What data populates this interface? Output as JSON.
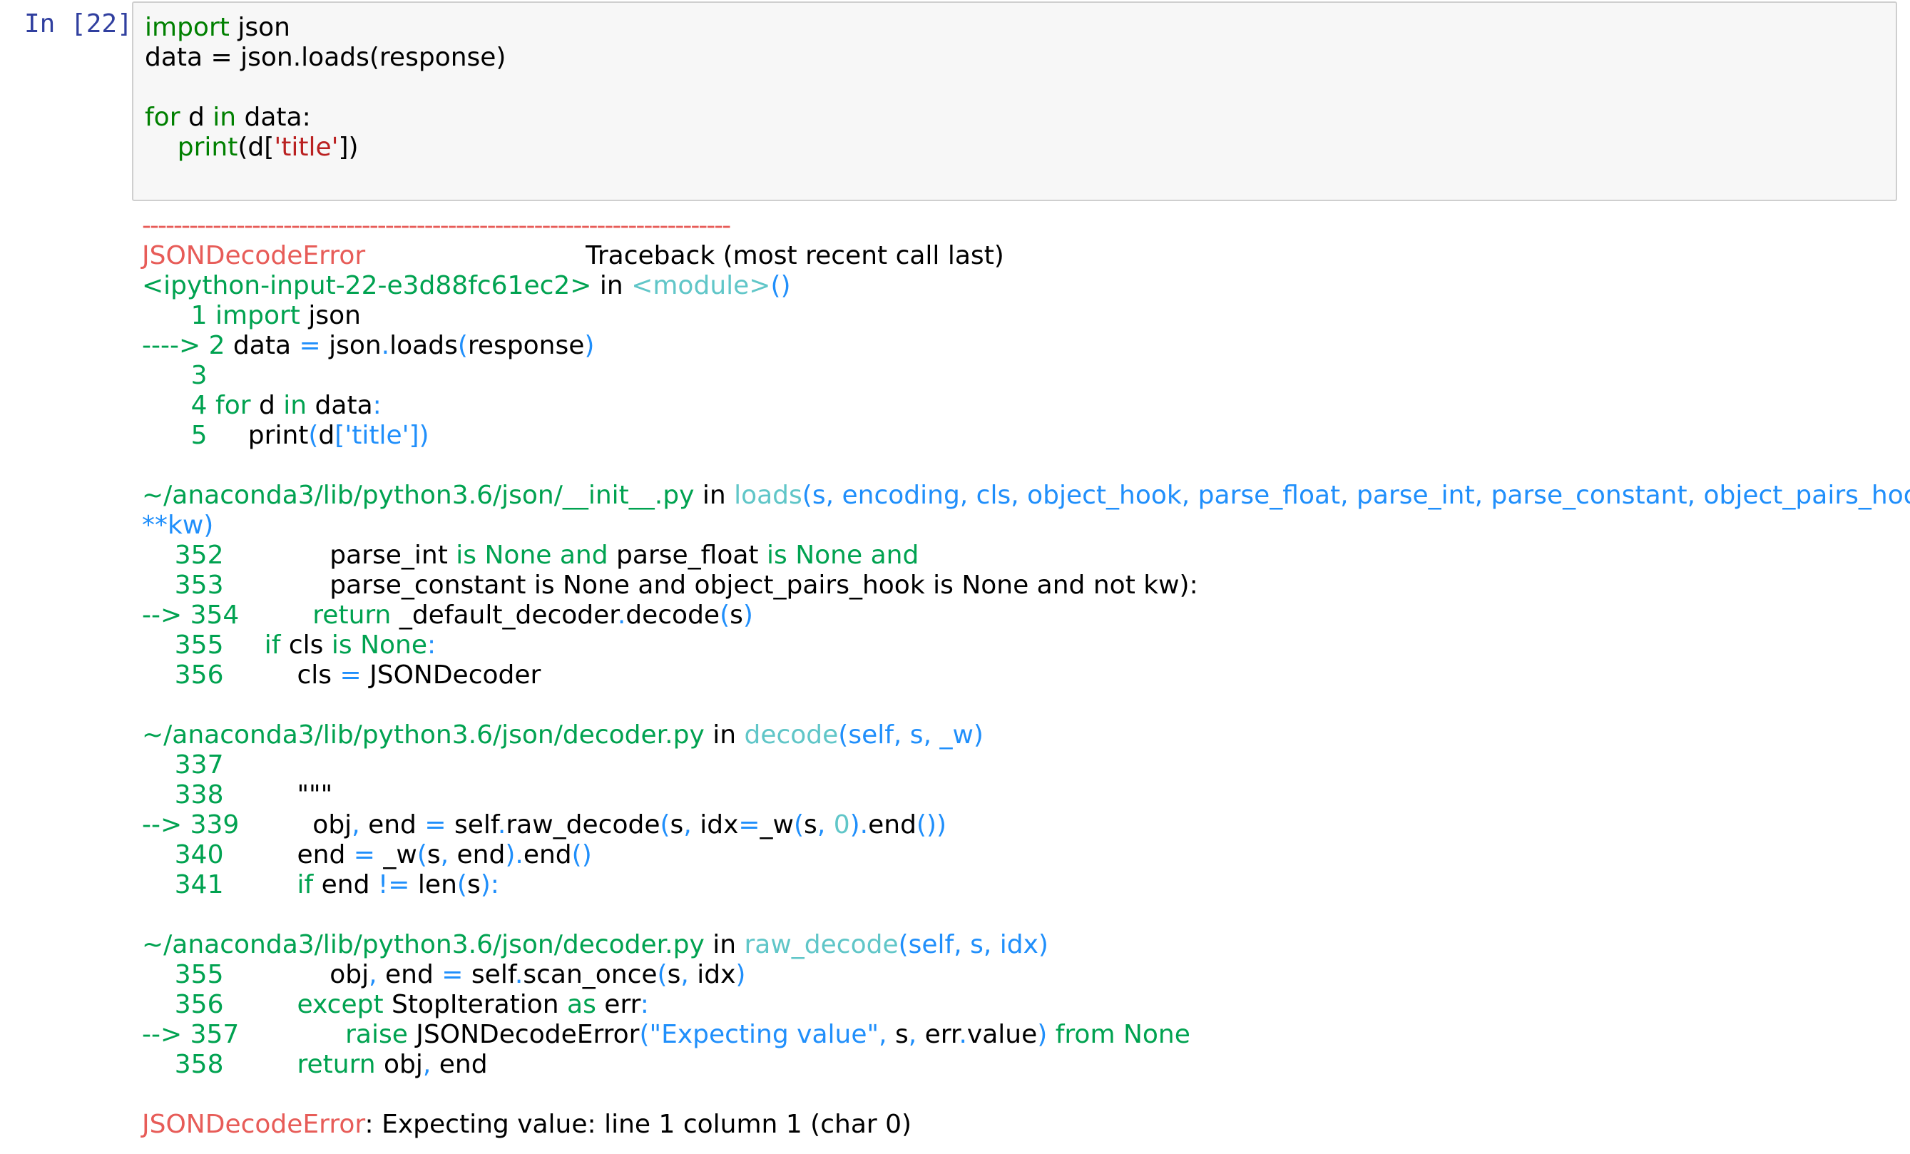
{
  "cell": {
    "prompt": "In [22]:",
    "input_lines": [
      [
        {
          "t": "import",
          "c": "kw"
        },
        {
          "t": " json",
          "c": ""
        }
      ],
      [
        {
          "t": "data = json.loads(response)",
          "c": ""
        }
      ],
      [
        {
          "t": "",
          "c": ""
        }
      ],
      [
        {
          "t": "for",
          "c": "kw"
        },
        {
          "t": " d ",
          "c": ""
        },
        {
          "t": "in",
          "c": "kw"
        },
        {
          "t": " data:",
          "c": ""
        }
      ],
      [
        {
          "t": "    ",
          "c": ""
        },
        {
          "t": "print",
          "c": "kw"
        },
        {
          "t": "(d[",
          "c": ""
        },
        {
          "t": "'title'",
          "c": "str"
        },
        {
          "t": "])",
          "c": ""
        }
      ]
    ]
  },
  "traceback": {
    "lines": [
      [
        {
          "t": "---------------------------------------------------------------------------",
          "c": "dash"
        }
      ],
      [
        {
          "t": "JSONDecodeError",
          "c": "red"
        },
        {
          "t": "                           Traceback (most recent call last)",
          "c": ""
        }
      ],
      [
        {
          "t": "<ipython-input-22-e3d88fc61ec2>",
          "c": "green"
        },
        {
          "t": " in ",
          "c": ""
        },
        {
          "t": "<module>",
          "c": "cyan"
        },
        {
          "t": "()",
          "c": "blue"
        }
      ],
      [
        {
          "t": "      1 ",
          "c": "green"
        },
        {
          "t": "import",
          "c": "green"
        },
        {
          "t": " json",
          "c": ""
        }
      ],
      [
        {
          "t": "----> 2 ",
          "c": "green"
        },
        {
          "t": "data ",
          "c": ""
        },
        {
          "t": "=",
          "c": "blue"
        },
        {
          "t": " json",
          "c": ""
        },
        {
          "t": ".",
          "c": "blue"
        },
        {
          "t": "loads",
          "c": ""
        },
        {
          "t": "(",
          "c": "blue"
        },
        {
          "t": "response",
          "c": ""
        },
        {
          "t": ")",
          "c": "blue"
        }
      ],
      [
        {
          "t": "      3 ",
          "c": "green"
        }
      ],
      [
        {
          "t": "      4 ",
          "c": "green"
        },
        {
          "t": "for",
          "c": "green"
        },
        {
          "t": " d ",
          "c": ""
        },
        {
          "t": "in",
          "c": "green"
        },
        {
          "t": " data",
          "c": ""
        },
        {
          "t": ":",
          "c": "blue"
        }
      ],
      [
        {
          "t": "      5 ",
          "c": "green"
        },
        {
          "t": "    print",
          "c": ""
        },
        {
          "t": "(",
          "c": "blue"
        },
        {
          "t": "d",
          "c": ""
        },
        {
          "t": "[",
          "c": "blue"
        },
        {
          "t": "'title'",
          "c": "blue"
        },
        {
          "t": "])",
          "c": "blue"
        }
      ],
      [
        {
          "t": "",
          "c": ""
        }
      ],
      [
        {
          "t": "~/anaconda3/lib/python3.6/json/__init__.py",
          "c": "green"
        },
        {
          "t": " in ",
          "c": ""
        },
        {
          "t": "loads",
          "c": "cyan"
        },
        {
          "t": "(s, encoding, cls, object_hook, parse_float, parse_int, parse_constant, object_pairs_hook,",
          "c": "blue"
        }
      ],
      [
        {
          "t": "**kw)",
          "c": "blue"
        }
      ],
      [
        {
          "t": "    352 ",
          "c": "green"
        },
        {
          "t": "            parse_int ",
          "c": ""
        },
        {
          "t": "is",
          "c": "green"
        },
        {
          "t": " ",
          "c": ""
        },
        {
          "t": "None",
          "c": "green"
        },
        {
          "t": " ",
          "c": ""
        },
        {
          "t": "and",
          "c": "green"
        },
        {
          "t": " parse_float ",
          "c": ""
        },
        {
          "t": "is",
          "c": "green"
        },
        {
          "t": " ",
          "c": ""
        },
        {
          "t": "None",
          "c": "green"
        },
        {
          "t": " ",
          "c": ""
        },
        {
          "t": "and",
          "c": "green"
        }
      ],
      [
        {
          "t": "    353 ",
          "c": "green"
        },
        {
          "t": "            parse_constant is None and object_pairs_hook is None and not kw):",
          "c": ""
        }
      ],
      [
        {
          "t": "--> 354 ",
          "c": "green"
        },
        {
          "t": "        ",
          "c": ""
        },
        {
          "t": "return",
          "c": "green"
        },
        {
          "t": " _default_decoder",
          "c": ""
        },
        {
          "t": ".",
          "c": "blue"
        },
        {
          "t": "decode",
          "c": ""
        },
        {
          "t": "(",
          "c": "blue"
        },
        {
          "t": "s",
          "c": ""
        },
        {
          "t": ")",
          "c": "blue"
        }
      ],
      [
        {
          "t": "    355 ",
          "c": "green"
        },
        {
          "t": "    ",
          "c": ""
        },
        {
          "t": "if",
          "c": "green"
        },
        {
          "t": " cls ",
          "c": ""
        },
        {
          "t": "is",
          "c": "green"
        },
        {
          "t": " ",
          "c": ""
        },
        {
          "t": "None",
          "c": "green"
        },
        {
          "t": ":",
          "c": "blue"
        }
      ],
      [
        {
          "t": "    356 ",
          "c": "green"
        },
        {
          "t": "        cls ",
          "c": ""
        },
        {
          "t": "=",
          "c": "blue"
        },
        {
          "t": " JSONDecoder",
          "c": ""
        }
      ],
      [
        {
          "t": "",
          "c": ""
        }
      ],
      [
        {
          "t": "~/anaconda3/lib/python3.6/json/decoder.py",
          "c": "green"
        },
        {
          "t": " in ",
          "c": ""
        },
        {
          "t": "decode",
          "c": "cyan"
        },
        {
          "t": "(self, s, _w)",
          "c": "blue"
        }
      ],
      [
        {
          "t": "    337 ",
          "c": "green"
        }
      ],
      [
        {
          "t": "    338 ",
          "c": "green"
        },
        {
          "t": "        \"\"\"",
          "c": ""
        }
      ],
      [
        {
          "t": "--> 339 ",
          "c": "green"
        },
        {
          "t": "        obj",
          "c": ""
        },
        {
          "t": ",",
          "c": "blue"
        },
        {
          "t": " end ",
          "c": ""
        },
        {
          "t": "=",
          "c": "blue"
        },
        {
          "t": " self",
          "c": ""
        },
        {
          "t": ".",
          "c": "blue"
        },
        {
          "t": "raw_decode",
          "c": ""
        },
        {
          "t": "(",
          "c": "blue"
        },
        {
          "t": "s",
          "c": ""
        },
        {
          "t": ",",
          "c": "blue"
        },
        {
          "t": " idx",
          "c": ""
        },
        {
          "t": "=",
          "c": "blue"
        },
        {
          "t": "_w",
          "c": ""
        },
        {
          "t": "(",
          "c": "blue"
        },
        {
          "t": "s",
          "c": ""
        },
        {
          "t": ",",
          "c": "blue"
        },
        {
          "t": " ",
          "c": ""
        },
        {
          "t": "0",
          "c": "cyan"
        },
        {
          "t": ")",
          "c": "blue"
        },
        {
          "t": ".",
          "c": "blue"
        },
        {
          "t": "end",
          "c": ""
        },
        {
          "t": "())",
          "c": "blue"
        }
      ],
      [
        {
          "t": "    340 ",
          "c": "green"
        },
        {
          "t": "        end ",
          "c": ""
        },
        {
          "t": "=",
          "c": "blue"
        },
        {
          "t": " _w",
          "c": ""
        },
        {
          "t": "(",
          "c": "blue"
        },
        {
          "t": "s",
          "c": ""
        },
        {
          "t": ",",
          "c": "blue"
        },
        {
          "t": " end",
          "c": ""
        },
        {
          "t": ")",
          "c": "blue"
        },
        {
          "t": ".",
          "c": "blue"
        },
        {
          "t": "end",
          "c": ""
        },
        {
          "t": "()",
          "c": "blue"
        }
      ],
      [
        {
          "t": "    341 ",
          "c": "green"
        },
        {
          "t": "        ",
          "c": ""
        },
        {
          "t": "if",
          "c": "green"
        },
        {
          "t": " end ",
          "c": ""
        },
        {
          "t": "!=",
          "c": "blue"
        },
        {
          "t": " len",
          "c": ""
        },
        {
          "t": "(",
          "c": "blue"
        },
        {
          "t": "s",
          "c": ""
        },
        {
          "t": "):",
          "c": "blue"
        }
      ],
      [
        {
          "t": "",
          "c": ""
        }
      ],
      [
        {
          "t": "~/anaconda3/lib/python3.6/json/decoder.py",
          "c": "green"
        },
        {
          "t": " in ",
          "c": ""
        },
        {
          "t": "raw_decode",
          "c": "cyan"
        },
        {
          "t": "(self, s, idx)",
          "c": "blue"
        }
      ],
      [
        {
          "t": "    355 ",
          "c": "green"
        },
        {
          "t": "            obj",
          "c": ""
        },
        {
          "t": ",",
          "c": "blue"
        },
        {
          "t": " end ",
          "c": ""
        },
        {
          "t": "=",
          "c": "blue"
        },
        {
          "t": " self",
          "c": ""
        },
        {
          "t": ".",
          "c": "blue"
        },
        {
          "t": "scan_once",
          "c": ""
        },
        {
          "t": "(",
          "c": "blue"
        },
        {
          "t": "s",
          "c": ""
        },
        {
          "t": ",",
          "c": "blue"
        },
        {
          "t": " idx",
          "c": ""
        },
        {
          "t": ")",
          "c": "blue"
        }
      ],
      [
        {
          "t": "    356 ",
          "c": "green"
        },
        {
          "t": "        ",
          "c": ""
        },
        {
          "t": "except",
          "c": "green"
        },
        {
          "t": " StopIteration ",
          "c": ""
        },
        {
          "t": "as",
          "c": "green"
        },
        {
          "t": " err",
          "c": ""
        },
        {
          "t": ":",
          "c": "blue"
        }
      ],
      [
        {
          "t": "--> 357 ",
          "c": "green"
        },
        {
          "t": "            ",
          "c": ""
        },
        {
          "t": "raise",
          "c": "green"
        },
        {
          "t": " JSONDecodeError",
          "c": ""
        },
        {
          "t": "(",
          "c": "blue"
        },
        {
          "t": "\"Expecting value\"",
          "c": "blue"
        },
        {
          "t": ",",
          "c": "blue"
        },
        {
          "t": " s",
          "c": ""
        },
        {
          "t": ",",
          "c": "blue"
        },
        {
          "t": " err",
          "c": ""
        },
        {
          "t": ".",
          "c": "blue"
        },
        {
          "t": "value",
          "c": ""
        },
        {
          "t": ")",
          "c": "blue"
        },
        {
          "t": " ",
          "c": ""
        },
        {
          "t": "from",
          "c": "green"
        },
        {
          "t": " ",
          "c": ""
        },
        {
          "t": "None",
          "c": "green"
        }
      ],
      [
        {
          "t": "    358 ",
          "c": "green"
        },
        {
          "t": "        ",
          "c": ""
        },
        {
          "t": "return",
          "c": "green"
        },
        {
          "t": " obj",
          "c": ""
        },
        {
          "t": ",",
          "c": "blue"
        },
        {
          "t": " end",
          "c": ""
        }
      ],
      [
        {
          "t": "",
          "c": ""
        }
      ],
      [
        {
          "t": "JSONDecodeError",
          "c": "red"
        },
        {
          "t": ": Expecting value: line 1 column 1 (char 0)",
          "c": ""
        }
      ]
    ]
  },
  "colors": {
    "prompt": "#303f9f",
    "keyword": "#008000",
    "string": "#ba2121",
    "error_red": "#e75c58",
    "cyan": "#60c6c8",
    "blue": "#208ffb",
    "green": "#00a250",
    "input_bg": "#f7f7f7"
  }
}
